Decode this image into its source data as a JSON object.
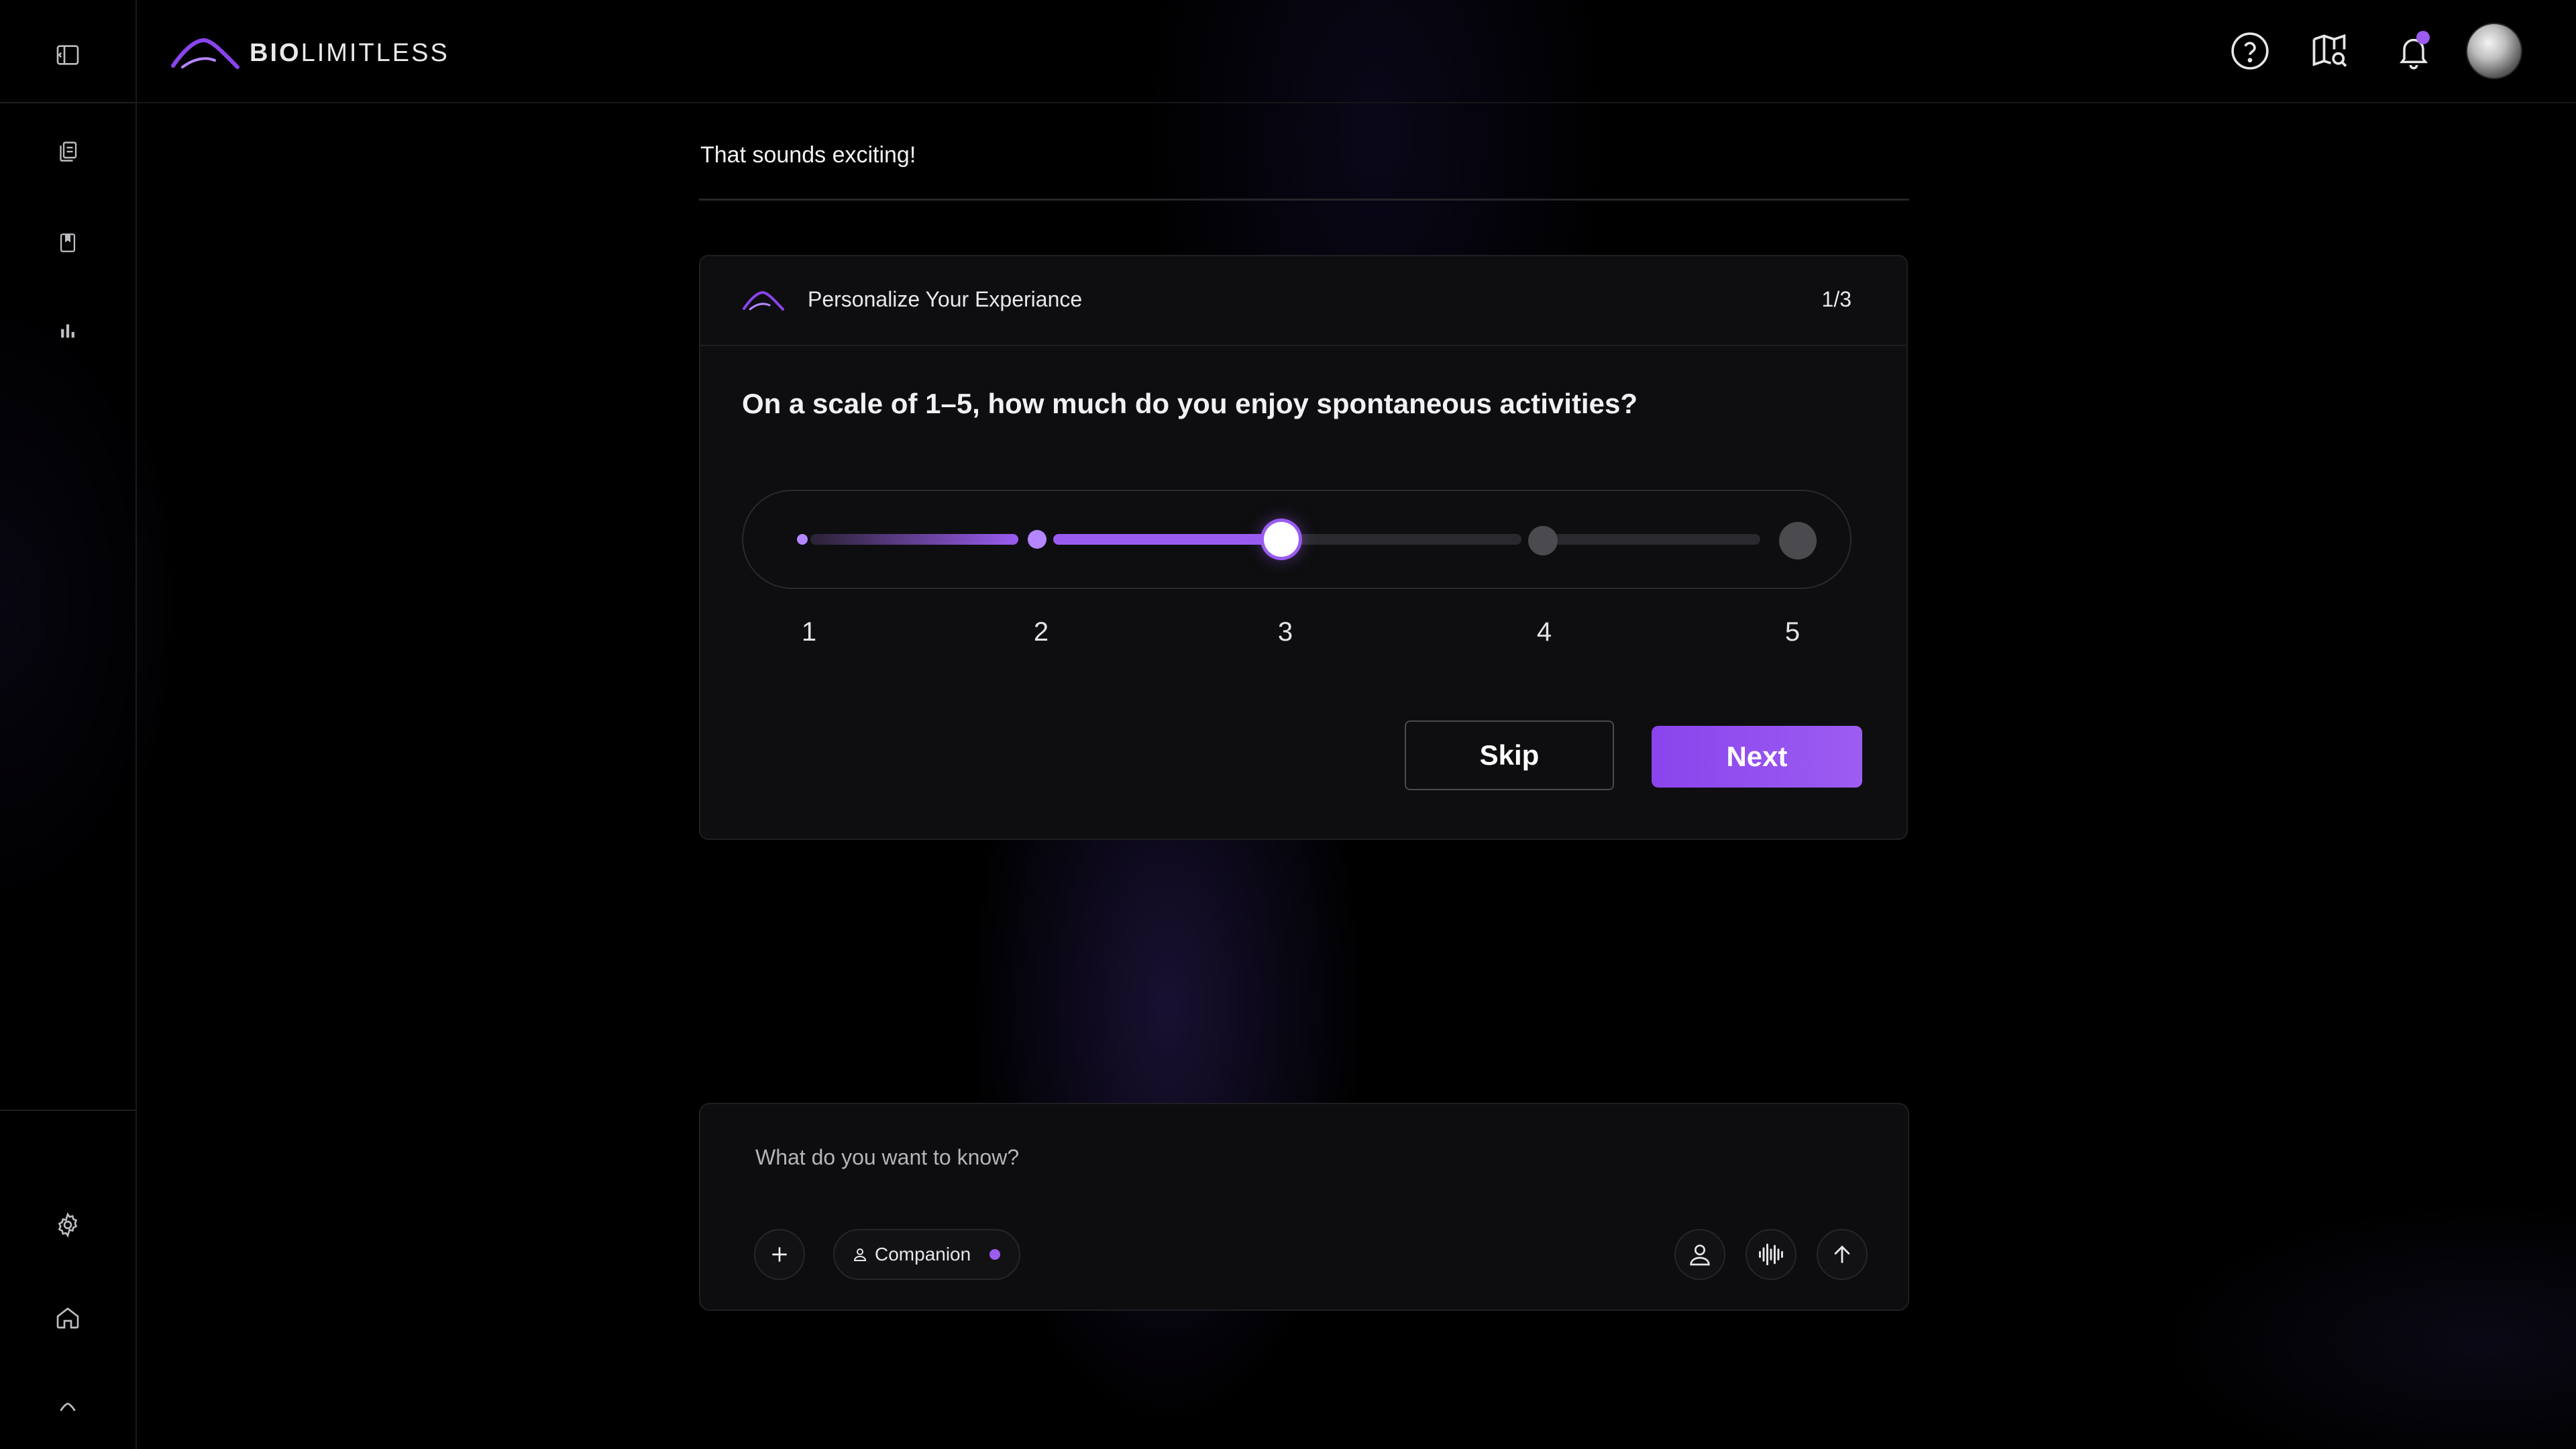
{
  "app": {
    "logo_bold": "BIO",
    "logo_light": "LIMITLESS",
    "accent_color": "#9d5cf0"
  },
  "sidebar": {
    "top_items": [
      {
        "name": "toggle-sidebar",
        "icon": "sidebar-panel-icon"
      },
      {
        "name": "history",
        "icon": "pages-icon"
      },
      {
        "name": "bookmarks",
        "icon": "bookmark-icon"
      },
      {
        "name": "analytics",
        "icon": "bar-chart-icon"
      }
    ],
    "bottom_items": [
      {
        "name": "settings",
        "icon": "gear-icon"
      },
      {
        "name": "home",
        "icon": "home-icon"
      },
      {
        "name": "brand",
        "icon": "logo-mark-icon"
      }
    ]
  },
  "topbar": {
    "icons": [
      "help-icon",
      "map-search-icon",
      "bell-icon"
    ],
    "notification_dot": true
  },
  "chat": {
    "message": "That sounds exciting!"
  },
  "survey": {
    "title": "Personalize Your Experiance",
    "progress": "1/3",
    "question": "On a scale of 1–5, how much do you enjoy spontaneous activities?",
    "scale_labels": [
      "1",
      "2",
      "3",
      "4",
      "5"
    ],
    "selected_value": 3,
    "skip_label": "Skip",
    "next_label": "Next"
  },
  "composer": {
    "placeholder": "What do you want to know?",
    "mode_chip": "Companion",
    "icons": [
      "plus-icon",
      "person-icon",
      "audio-wave-icon",
      "send-arrow-icon"
    ]
  }
}
